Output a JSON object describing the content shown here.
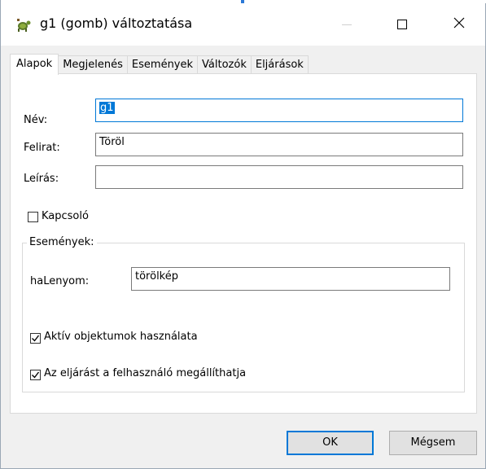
{
  "window": {
    "title": "g1 (gomb) változtatása"
  },
  "tabs": [
    {
      "label": "Alapok",
      "active": true
    },
    {
      "label": "Megjelenés",
      "active": false
    },
    {
      "label": "Események",
      "active": false
    },
    {
      "label": "Változók",
      "active": false
    },
    {
      "label": "Eljárások",
      "active": false
    }
  ],
  "form": {
    "name_label": "Név:",
    "name_value": "g1",
    "caption_label": "Felirat:",
    "caption_value": "Töröl",
    "description_label": "Leírás:",
    "description_value": "",
    "toggle_label": "Kapcsoló",
    "toggle_checked": false
  },
  "events_group": {
    "title": "Események:",
    "on_click_label": "haLenyom:",
    "on_click_value": "törölkép",
    "active_objects_label": "Aktív objektumok használata",
    "active_objects_checked": true,
    "user_can_stop_label": "Az eljárást a felhasználó megállíthatja",
    "user_can_stop_checked": true
  },
  "buttons": {
    "ok_label": "OK",
    "cancel_label": "Mégsem"
  },
  "colors": {
    "accent": "#0078d7",
    "titlebar": "#ffffff",
    "dialog_bg": "#f0f0f0"
  },
  "icons": {
    "app": "turtle-icon",
    "minimize": "minimize-icon",
    "maximize": "maximize-icon",
    "close": "close-icon"
  }
}
